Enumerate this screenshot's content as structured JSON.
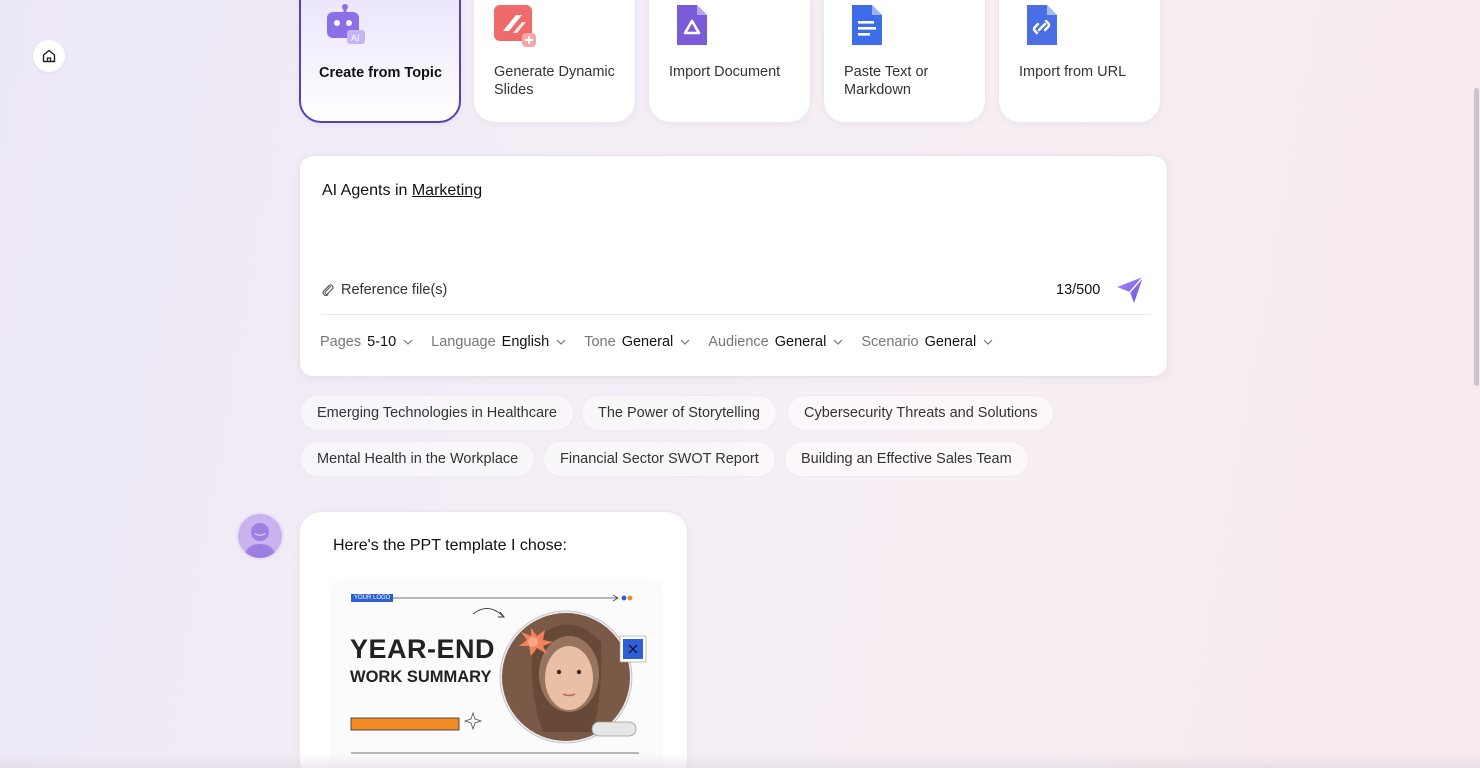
{
  "cards": [
    {
      "label": "Create from Topic",
      "icon": "robot-ai-icon",
      "active": true
    },
    {
      "label": "Generate Dynamic Slides",
      "icon": "dynamic-slides-icon"
    },
    {
      "label": "Import Document",
      "icon": "document-icon"
    },
    {
      "label": "Paste Text or Markdown",
      "icon": "markdown-doc-icon"
    },
    {
      "label": "Import from URL",
      "icon": "link-doc-icon"
    }
  ],
  "input": {
    "topic_prefix": "AI Agents in ",
    "topic_underlined": "Marketing",
    "reference_label": "Reference file(s)",
    "char_count": "13/500"
  },
  "options": [
    {
      "key": "Pages",
      "value": "5-10"
    },
    {
      "key": "Language",
      "value": "English"
    },
    {
      "key": "Tone",
      "value": "General"
    },
    {
      "key": "Audience",
      "value": "General"
    },
    {
      "key": "Scenario",
      "value": "General"
    }
  ],
  "suggestions": [
    "Emerging Technologies in Healthcare",
    "The Power of Storytelling",
    "Cybersecurity Threats and Solutions",
    "Mental Health in the Workplace",
    "Financial Sector SWOT Report",
    "Building an Effective Sales Team"
  ],
  "chat": {
    "message": "Here's the PPT template I chose:",
    "template": {
      "logo_tag": "YOUR LOGO",
      "title": "YEAR-END",
      "subtitle": "WORK SUMMARY"
    }
  },
  "colors": {
    "accent": "#5b3fb8",
    "send": "#8b6cf0"
  }
}
